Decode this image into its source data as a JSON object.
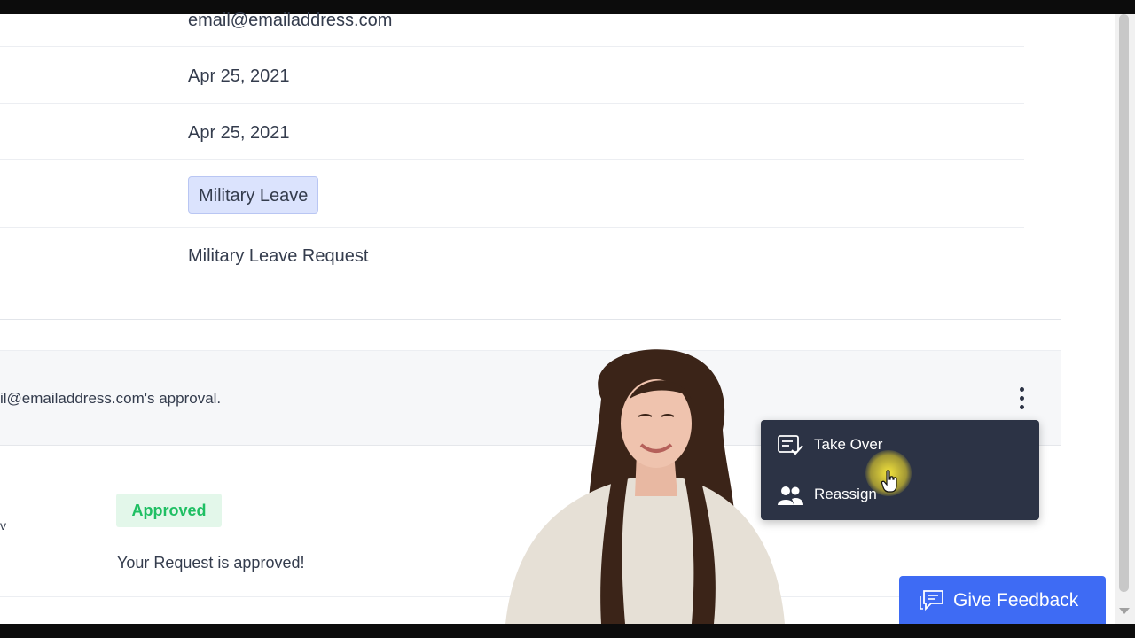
{
  "details": {
    "email": "email@emailaddress.com",
    "start_date": "Apr 25, 2021",
    "end_date": "Apr 25, 2021",
    "leave_type": "Military Leave",
    "request_title": "Military Leave Request"
  },
  "approval_step": {
    "message": "il@emailaddress.com's approval."
  },
  "menu": {
    "items": [
      {
        "label": "Take Over",
        "icon": "take-over-icon"
      },
      {
        "label": "Reassign",
        "icon": "reassign-people-icon"
      }
    ]
  },
  "history": {
    "edge_text": "v",
    "status": "Approved",
    "message": "Your Request is approved!"
  },
  "feedback": {
    "label": "Give Feedback",
    "icon": "chat-feedback-icon"
  },
  "colors": {
    "accent": "#3e6bf4",
    "menu_bg": "#2c3345",
    "approved_text": "#1fbf63",
    "approved_bg": "#e3f7ea",
    "tag_bg": "#dbe3fd"
  }
}
